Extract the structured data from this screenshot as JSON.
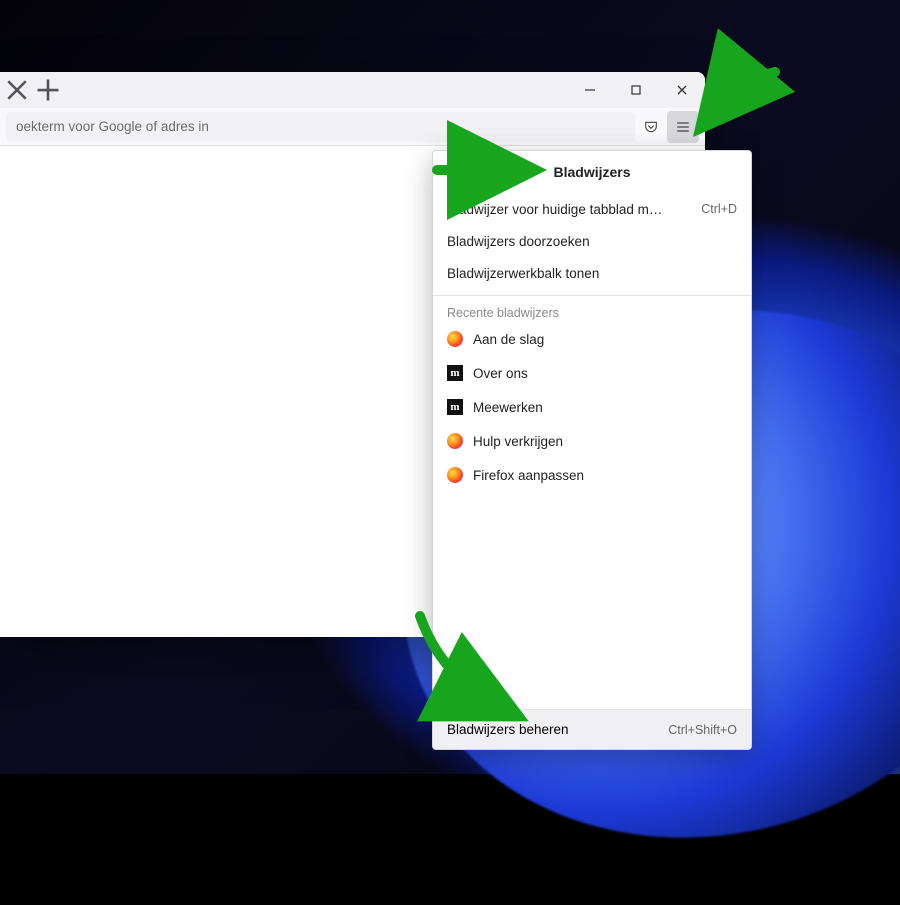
{
  "addressbar": {
    "placeholder": "oekterm voor Google of adres in"
  },
  "menu": {
    "title": "Bladwijzers",
    "items": [
      {
        "label": "Bladwijzer voor huidige tabblad m…",
        "shortcut": "Ctrl+D"
      },
      {
        "label": "Bladwijzers doorzoeken",
        "shortcut": ""
      },
      {
        "label": "Bladwijzerwerkbalk tonen",
        "shortcut": ""
      }
    ],
    "recent_title": "Recente bladwijzers",
    "recent": [
      {
        "icon": "firefox",
        "label": "Aan de slag"
      },
      {
        "icon": "m",
        "label": "Over ons"
      },
      {
        "icon": "m",
        "label": "Meewerken"
      },
      {
        "icon": "firefox",
        "label": "Hulp verkrijgen"
      },
      {
        "icon": "firefox",
        "label": "Firefox aanpassen"
      }
    ],
    "footer": {
      "label": "Bladwijzers beheren",
      "shortcut": "Ctrl+Shift+O"
    }
  }
}
